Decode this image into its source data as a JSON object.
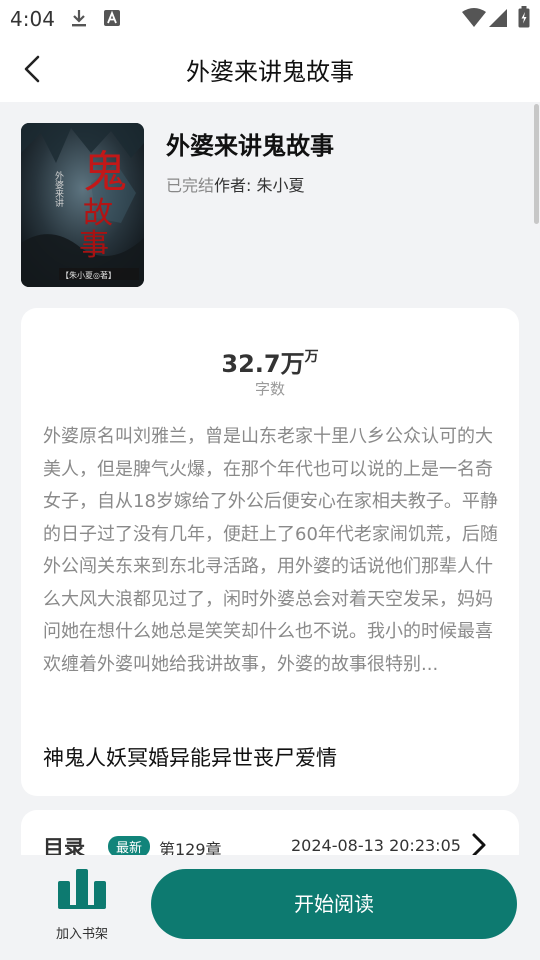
{
  "status_bar": {
    "time": "4:04",
    "left_icons": [
      "download-icon",
      "a-notification-icon"
    ],
    "right_icons": [
      "wifi-icon",
      "signal-icon",
      "battery-icon"
    ]
  },
  "header": {
    "title": "外婆来讲鬼故事"
  },
  "book": {
    "title": "外婆来讲鬼故事",
    "status": "已完结",
    "author": "作者: 朱小夏",
    "cover": {
      "big_char": "鬼",
      "chars_2": "故",
      "chars_3": "事",
      "side_text": "外婆来讲",
      "author_strip": "【朱小夏◎著】"
    }
  },
  "stats": {
    "word_count": "32.7万",
    "word_count_unit": "万",
    "word_count_label": "字数"
  },
  "description": "外婆原名叫刘雅兰，曾是山东老家十里八乡公众认可的大美人，但是脾气火爆，在那个年代也可以说的上是一名奇女子，自从18岁嫁给了外公后便安心在家相夫教子。平静的日子过了没有几年，便赶上了60年代老家闹饥荒，后随外公闯关东来到东北寻活路，用外婆的话说他们那辈人什么大风大浪都见过了，闲时外婆总会对着天空发呆，妈妈问她在想什么她总是笑笑却什么也不说。我小的时候最喜欢缠着外婆叫她给我讲故事，外婆的故事很特别...",
  "tags": "神鬼人妖冥婚异能异世丧尸爱情",
  "toc": {
    "label": "目录",
    "new_badge": "最新",
    "latest_chapter": "第129章",
    "updated": "2024-08-13 20:23:05"
  },
  "bottom": {
    "shelf_label": "加入书架",
    "read_button": "开始阅读"
  },
  "colors": {
    "accent": "#0d7a70",
    "badge": "#11847a"
  }
}
